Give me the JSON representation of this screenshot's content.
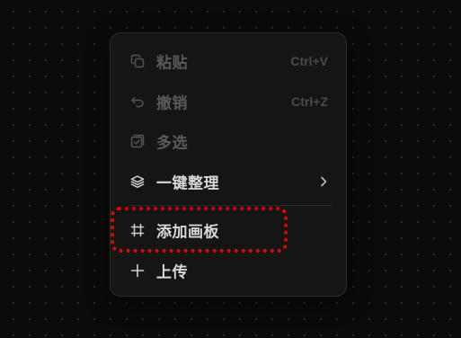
{
  "menu": {
    "items": [
      {
        "id": "paste",
        "label": "粘贴",
        "shortcut": "Ctrl+V",
        "enabled": false,
        "icon": "copy-icon"
      },
      {
        "id": "undo",
        "label": "撤销",
        "shortcut": "Ctrl+Z",
        "enabled": false,
        "icon": "undo-icon"
      },
      {
        "id": "multi-select",
        "label": "多选",
        "enabled": false,
        "icon": "checkbox-stack-icon"
      },
      {
        "id": "organize",
        "label": "一键整理",
        "enabled": true,
        "icon": "layers-icon",
        "has_submenu": true
      },
      {
        "id": "add-board",
        "label": "添加画板",
        "enabled": true,
        "icon": "frame-icon"
      },
      {
        "id": "upload",
        "label": "上传",
        "enabled": true,
        "icon": "plus-icon"
      }
    ]
  },
  "colors": {
    "background": "#0b0b0b",
    "menu_background": "#151515",
    "enabled_text": "#d8d8d8",
    "disabled_text": "#5a5a5a",
    "highlight": "#e0060b"
  }
}
